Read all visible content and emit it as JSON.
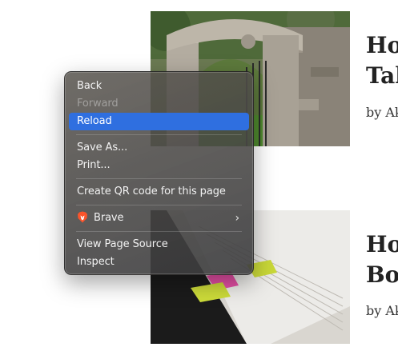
{
  "articles": [
    {
      "title_lines": [
        "Ho",
        "Tal"
      ],
      "byline": "by Ak",
      "image": "stone-archway-gate-photo"
    },
    {
      "title_lines": [
        "Ho",
        "Boo"
      ],
      "byline": "by Ak",
      "image": "book-with-sticky-tabs-photo"
    }
  ],
  "context_menu": {
    "items": [
      {
        "label": "Back",
        "state": "enabled"
      },
      {
        "label": "Forward",
        "state": "disabled"
      },
      {
        "label": "Reload",
        "state": "highlighted"
      },
      {
        "label": "Save As...",
        "state": "enabled"
      },
      {
        "label": "Print...",
        "state": "enabled"
      },
      {
        "label": "Create QR code for this page",
        "state": "enabled"
      },
      {
        "label": "Brave",
        "state": "enabled",
        "icon": "brave-lion-icon",
        "submenu": true
      },
      {
        "label": "View Page Source",
        "state": "enabled"
      },
      {
        "label": "Inspect",
        "state": "enabled"
      }
    ],
    "submenu_indicator": "›",
    "highlight_color": "#2f6fe0"
  }
}
